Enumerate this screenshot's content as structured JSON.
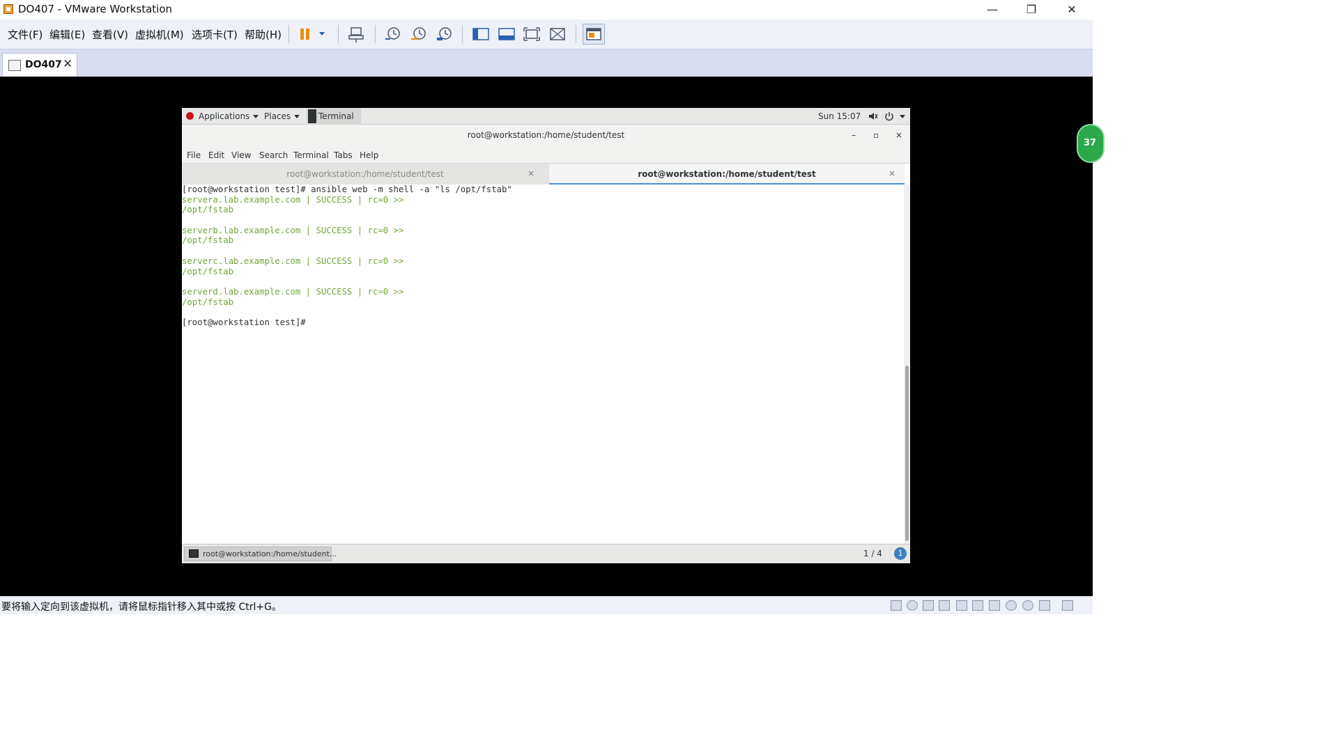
{
  "window": {
    "title": "DO407 - VMware Workstation",
    "controls": {
      "minimize": "—",
      "restore": "❐",
      "close": "✕"
    }
  },
  "menu": [
    "文件(F)",
    "编辑(E)",
    "查看(V)",
    "虚拟机(M)",
    "选项卡(T)",
    "帮助(H)"
  ],
  "toolbar_icons": [
    "pause-icon",
    "dropdown-icon",
    "send-ctrl-alt-del-icon",
    "snapshot-icon",
    "revert-snapshot-icon",
    "snapshot-manager-icon",
    "library-view-icon",
    "thumbnail-view-icon",
    "fullscreen-icon",
    "unity-icon",
    "console-view-icon"
  ],
  "vm_tab": {
    "label": "DO407",
    "close": "✕"
  },
  "gnome": {
    "applications": "Applications",
    "places": "Places",
    "terminal": "Terminal",
    "clock": "Sun 15:07"
  },
  "terminal": {
    "title": "root@workstation:/home/student/test",
    "controls": {
      "minimize": "–",
      "maximize": "▫",
      "close": "×"
    },
    "menu": [
      "File",
      "Edit",
      "View",
      "Search",
      "Terminal",
      "Tabs",
      "Help"
    ],
    "tabs": [
      {
        "label": "root@workstation:/home/student/test",
        "close": "×",
        "active": false
      },
      {
        "label": "root@workstation:/home/student/test",
        "close": "×",
        "active": true
      }
    ],
    "lines": [
      {
        "text": "[root@workstation test]# ansible web -m shell -a \"ls /opt/fstab\"",
        "color": "#2e3436"
      },
      {
        "text": "servera.lab.example.com | SUCCESS | rc=0 >>",
        "color": "#73a63c"
      },
      {
        "text": "/opt/fstab",
        "color": "#73a63c"
      },
      {
        "text": "",
        "color": "#2e3436"
      },
      {
        "text": "serverb.lab.example.com | SUCCESS | rc=0 >>",
        "color": "#73a63c"
      },
      {
        "text": "/opt/fstab",
        "color": "#73a63c"
      },
      {
        "text": "",
        "color": "#2e3436"
      },
      {
        "text": "serverc.lab.example.com | SUCCESS | rc=0 >>",
        "color": "#73a63c"
      },
      {
        "text": "/opt/fstab",
        "color": "#73a63c"
      },
      {
        "text": "",
        "color": "#2e3436"
      },
      {
        "text": "serverd.lab.example.com | SUCCESS | rc=0 >>",
        "color": "#73a63c"
      },
      {
        "text": "/opt/fstab",
        "color": "#73a63c"
      },
      {
        "text": "",
        "color": "#2e3436"
      },
      {
        "text": "[root@workstation test]#",
        "color": "#2e3436"
      }
    ]
  },
  "taskbar": {
    "item": "root@workstation:/home/student...",
    "workspace": "1 / 4",
    "notification": "1"
  },
  "side_badge": "37",
  "status": {
    "text": "要将输入定向到该虚拟机，请将鼠标指针移入其中或按 Ctrl+G。"
  },
  "colors": {
    "success_green": "#73a63c",
    "accent_blue": "#4a90d9",
    "vmware_toolbar": "#eef1f8"
  }
}
